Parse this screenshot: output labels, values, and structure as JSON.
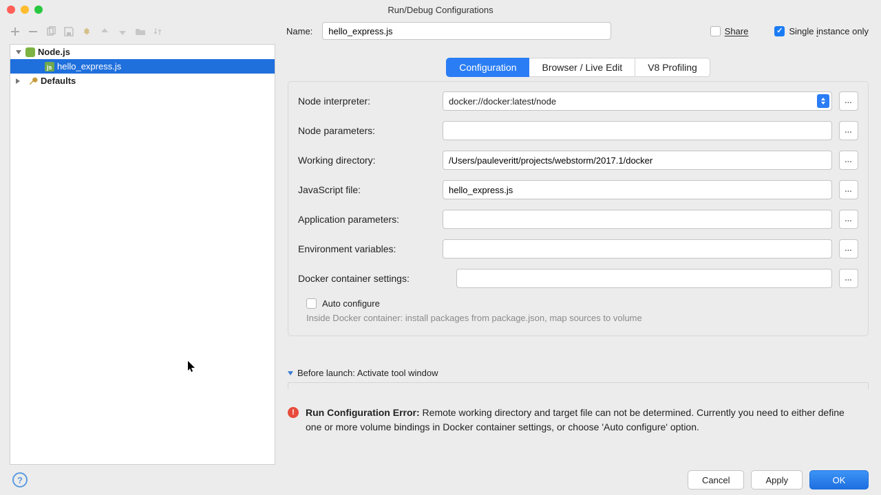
{
  "window": {
    "title": "Run/Debug Configurations"
  },
  "name_field": {
    "label": "Name:",
    "value": "hello_express.js"
  },
  "share": {
    "label": "Share",
    "checked": false
  },
  "single_instance": {
    "label": "Single instance only",
    "checked": true
  },
  "sidebar": {
    "nodejs": {
      "label": "Node.js",
      "expanded": true
    },
    "selected": {
      "label": "hello_express.js"
    },
    "defaults": {
      "label": "Defaults",
      "expanded": false
    }
  },
  "tabs": [
    {
      "label": "Configuration",
      "active": true
    },
    {
      "label": "Browser / Live Edit",
      "active": false
    },
    {
      "label": "V8 Profiling",
      "active": false
    }
  ],
  "form": {
    "node_interpreter": {
      "label": "Node interpreter:",
      "value": "docker://docker:latest/node"
    },
    "node_parameters": {
      "label": "Node parameters:",
      "value": ""
    },
    "working_directory": {
      "label": "Working directory:",
      "value": "/Users/pauleveritt/projects/webstorm/2017.1/docker"
    },
    "javascript_file": {
      "label": "JavaScript file:",
      "value": "hello_express.js"
    },
    "application_parameters": {
      "label": "Application parameters:",
      "value": ""
    },
    "environment_variables": {
      "label": "Environment variables:",
      "value": ""
    },
    "docker_settings": {
      "label": "Docker container settings:",
      "value": ""
    },
    "auto_configure": {
      "label": "Auto configure",
      "checked": false
    },
    "hint": "Inside Docker container: install packages from package.json, map sources to volume"
  },
  "before_launch": {
    "label": "Before launch: Activate tool window"
  },
  "error": {
    "title": "Run Configuration Error:",
    "text": " Remote working directory and target file can not be determined. Currently you need to either define one or more volume bindings in Docker container settings, or choose 'Auto configure' option."
  },
  "footer": {
    "cancel": "Cancel",
    "apply": "Apply",
    "ok": "OK"
  }
}
